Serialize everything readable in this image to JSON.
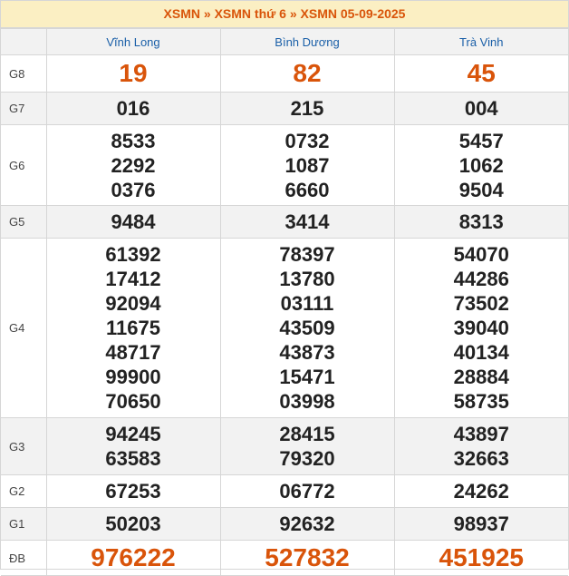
{
  "header": {
    "crumb1": "XSMN",
    "sep1": "»",
    "crumb2": "XSMN thứ 6",
    "sep2": "»",
    "crumb3": "XSMN 05-09-2025"
  },
  "provinces": [
    "Vĩnh Long",
    "Bình Dương",
    "Trà Vinh"
  ],
  "prizes": [
    {
      "label": "G8",
      "values": [
        [
          "19"
        ],
        [
          "82"
        ],
        [
          "45"
        ]
      ]
    },
    {
      "label": "G7",
      "values": [
        [
          "016"
        ],
        [
          "215"
        ],
        [
          "004"
        ]
      ]
    },
    {
      "label": "G6",
      "values": [
        [
          "8533",
          "2292",
          "0376"
        ],
        [
          "0732",
          "1087",
          "6660"
        ],
        [
          "5457",
          "1062",
          "9504"
        ]
      ]
    },
    {
      "label": "G5",
      "values": [
        [
          "9484"
        ],
        [
          "3414"
        ],
        [
          "8313"
        ]
      ]
    },
    {
      "label": "G4",
      "values": [
        [
          "61392",
          "17412",
          "92094",
          "11675",
          "48717",
          "99900",
          "70650"
        ],
        [
          "78397",
          "13780",
          "03111",
          "43509",
          "43873",
          "15471",
          "03998"
        ],
        [
          "54070",
          "44286",
          "73502",
          "39040",
          "40134",
          "28884",
          "58735"
        ]
      ]
    },
    {
      "label": "G3",
      "values": [
        [
          "94245",
          "63583"
        ],
        [
          "28415",
          "79320"
        ],
        [
          "43897",
          "32663"
        ]
      ]
    },
    {
      "label": "G2",
      "values": [
        [
          "67253"
        ],
        [
          "06772"
        ],
        [
          "24262"
        ]
      ]
    },
    {
      "label": "G1",
      "values": [
        [
          "50203"
        ],
        [
          "92632"
        ],
        [
          "98937"
        ]
      ]
    },
    {
      "label": "ĐB",
      "values": [
        [
          "976222"
        ],
        [
          "527832"
        ],
        [
          "451925"
        ]
      ]
    }
  ],
  "colors": {
    "accent": "#d9540a",
    "province": "#1a5fa8",
    "title_bg": "#fbefc3"
  }
}
